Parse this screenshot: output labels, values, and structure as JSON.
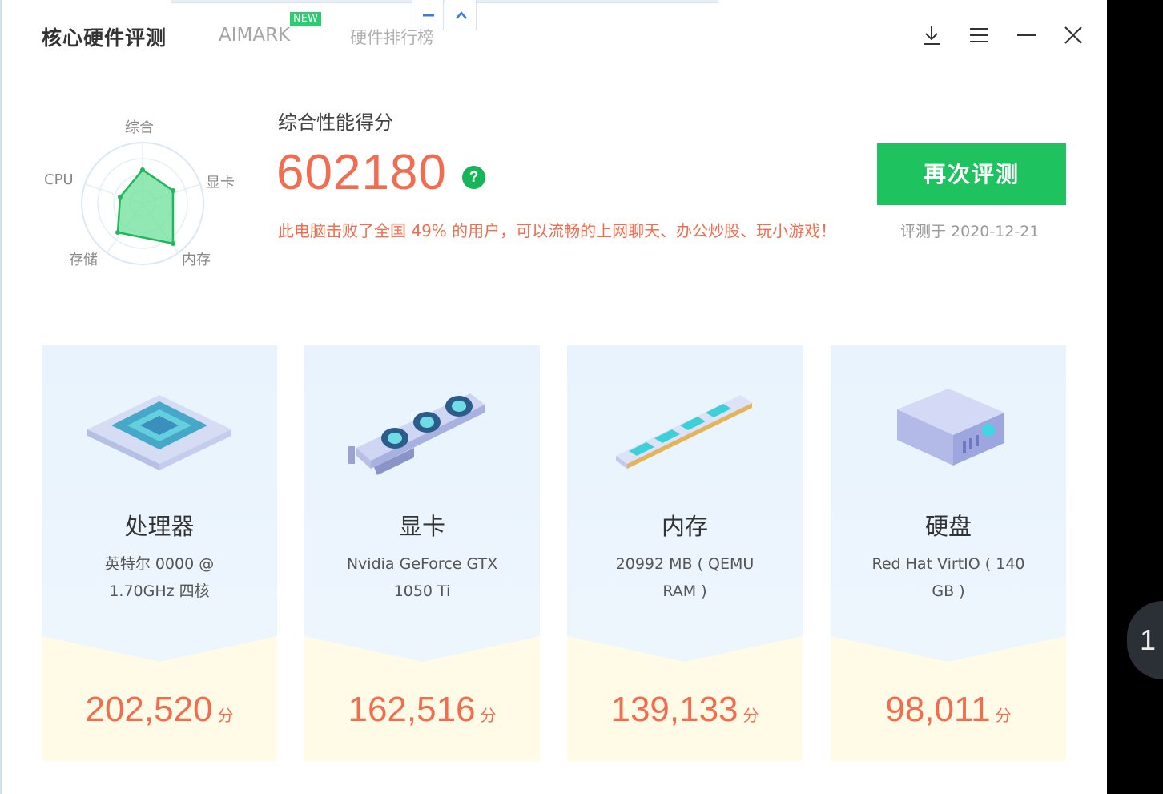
{
  "header": {
    "app_title": "核心硬件评测",
    "tabs": [
      "AIMARK",
      "硬件排行榜"
    ],
    "new_badge": "NEW"
  },
  "radar": {
    "labels": [
      "综合",
      "显卡",
      "内存",
      "存储",
      "CPU"
    ],
    "accent": "#2ecc71"
  },
  "score": {
    "heading": "综合性能得分",
    "value": "602180",
    "help": "?",
    "description": "此电脑击败了全国 49% 的用户，可以流畅的上网聊天、办公炒股、玩小游戏！"
  },
  "actions": {
    "retest": "再次评测",
    "date": "评测于 2020-12-21"
  },
  "cards": [
    {
      "title": "处理器",
      "line1": "英特尔 0000 @",
      "line2": "1.70GHz 四核",
      "score": "202,520",
      "unit": "分"
    },
    {
      "title": "显卡",
      "line1": "Nvidia GeForce GTX",
      "line2": "1050 Ti",
      "score": "162,516",
      "unit": "分"
    },
    {
      "title": "内存",
      "line1": "20992 MB ( QEMU",
      "line2": "RAM )",
      "score": "139,133",
      "unit": "分"
    },
    {
      "title": "硬盘",
      "line1": "Red Hat VirtIO ( 140",
      "line2": "GB )",
      "score": "98,011",
      "unit": "分"
    }
  ],
  "side_tab": "1"
}
